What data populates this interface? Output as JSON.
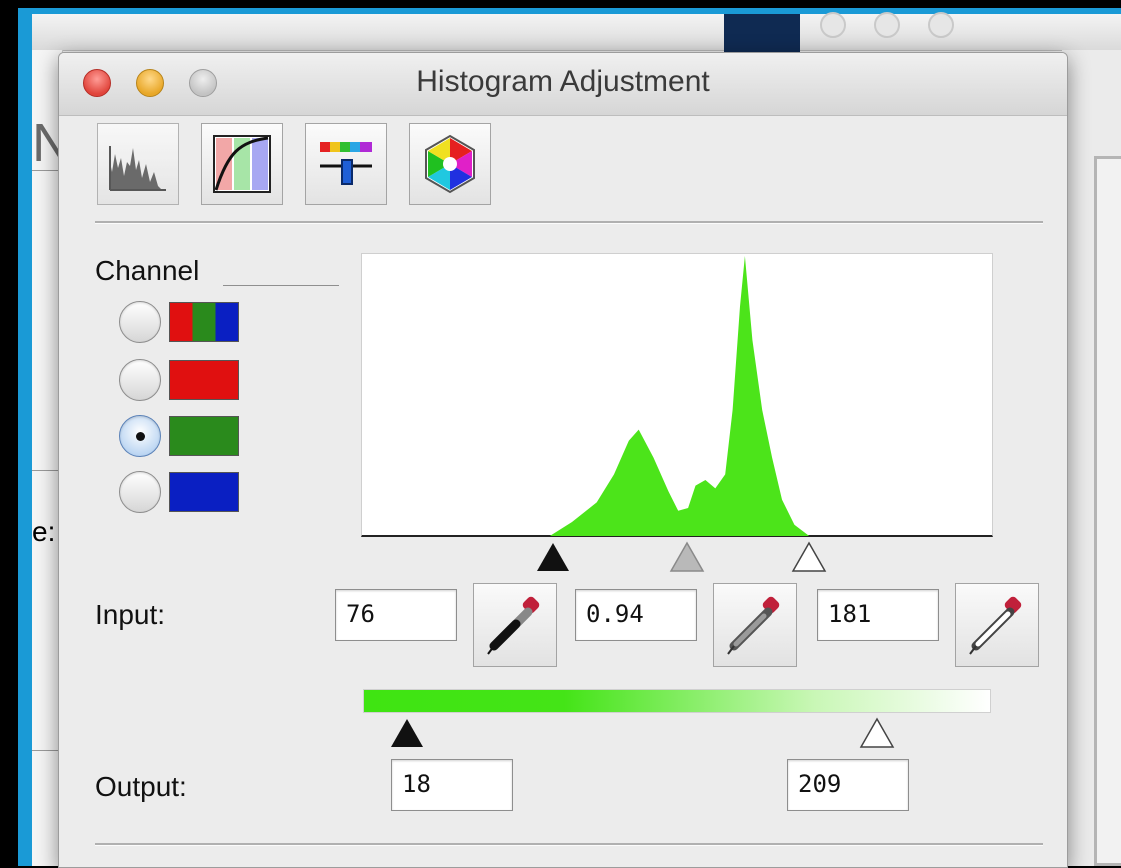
{
  "window": {
    "title": "Histogram Adjustment"
  },
  "toolbar": {
    "tools": [
      {
        "name": "histogram",
        "icon": "histogram-icon"
      },
      {
        "name": "curves",
        "icon": "curves-icon"
      },
      {
        "name": "color-balance",
        "icon": "color-balance-icon"
      },
      {
        "name": "hue-saturation",
        "icon": "color-wheel-icon"
      }
    ]
  },
  "channel": {
    "label": "Channel",
    "options": [
      {
        "name": "rgb",
        "colors": [
          "#e01010",
          "#2a8a1c",
          "#0a1fc2"
        ],
        "selected": false
      },
      {
        "name": "red",
        "colors": [
          "#e01010"
        ],
        "selected": false
      },
      {
        "name": "green",
        "colors": [
          "#2a8a1c"
        ],
        "selected": true
      },
      {
        "name": "blue",
        "colors": [
          "#0a1fc2"
        ],
        "selected": false
      }
    ]
  },
  "histogram": {
    "channel": "green",
    "fill": "#4ce41a",
    "level_range": [
      0,
      255
    ],
    "counts_relative": [
      [
        76,
        0
      ],
      [
        85,
        0.05
      ],
      [
        95,
        0.12
      ],
      [
        102,
        0.22
      ],
      [
        108,
        0.34
      ],
      [
        112,
        0.38
      ],
      [
        118,
        0.28
      ],
      [
        124,
        0.16
      ],
      [
        128,
        0.09
      ],
      [
        132,
        0.1
      ],
      [
        135,
        0.18
      ],
      [
        139,
        0.2
      ],
      [
        143,
        0.17
      ],
      [
        147,
        0.22
      ],
      [
        150,
        0.45
      ],
      [
        153,
        0.82
      ],
      [
        155,
        1.0
      ],
      [
        158,
        0.7
      ],
      [
        162,
        0.45
      ],
      [
        166,
        0.28
      ],
      [
        170,
        0.13
      ],
      [
        175,
        0.04
      ],
      [
        181,
        0
      ]
    ]
  },
  "input": {
    "label": "Input:",
    "black_point": "76",
    "gamma": "0.94",
    "white_point": "181"
  },
  "output": {
    "label": "Output:",
    "black_point": "18",
    "white_point": "209",
    "gradient_color": "#44e417"
  },
  "background": {
    "left_label": "e:"
  }
}
